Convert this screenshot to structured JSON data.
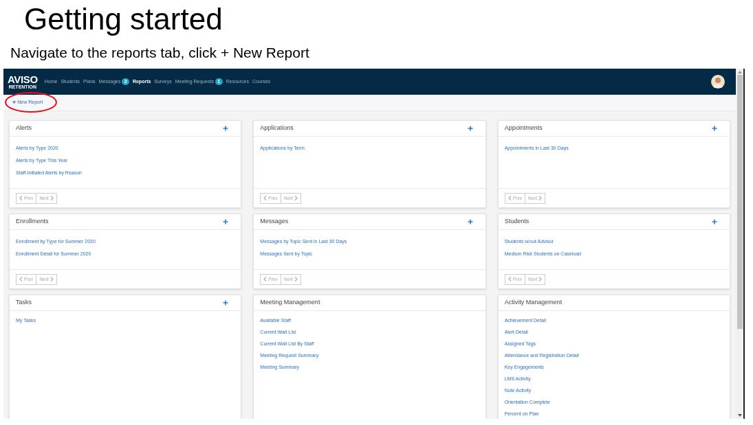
{
  "slide": {
    "title": "Getting started",
    "subtitle": "Navigate to the reports tab, click + New Report"
  },
  "app": {
    "logo": {
      "name": "AVISO",
      "tagline": "RETENTION"
    },
    "nav": [
      {
        "label": "Home",
        "selected": false
      },
      {
        "label": "Students",
        "selected": false
      },
      {
        "label": "Plans",
        "selected": false
      },
      {
        "label": "Messages",
        "badge": "2",
        "selected": false
      },
      {
        "label": "Reports",
        "selected": true
      },
      {
        "label": "Surveys",
        "selected": false
      },
      {
        "label": "Meeting Requests",
        "badge": "1",
        "selected": false
      },
      {
        "label": "Resources",
        "selected": false
      },
      {
        "label": "Courses",
        "selected": false
      }
    ],
    "toolbar": {
      "new_button": {
        "icon": "+",
        "label": "New Report",
        "highlighted": true
      }
    },
    "cards": [
      {
        "title": "Alerts",
        "addable": true,
        "links": [
          "Alerts by Type 2020",
          "Alerts by Type This Year",
          "Staff-Initiated Alerts by Reason"
        ],
        "pager": [
          {
            "label": "Prev",
            "kind": "prev",
            "disabled": true
          },
          {
            "label": "Next",
            "kind": "next",
            "disabled": true
          }
        ]
      },
      {
        "title": "Applications",
        "addable": true,
        "links": [
          "Applications by Term"
        ],
        "pager": [
          {
            "label": "Prev",
            "kind": "prev",
            "disabled": true
          },
          {
            "label": "Next",
            "kind": "next",
            "disabled": true
          }
        ]
      },
      {
        "title": "Appointments",
        "addable": true,
        "links": [
          "Appointments in Last 30 Days"
        ],
        "pager": [
          {
            "label": "Prev",
            "kind": "prev",
            "disabled": true
          },
          {
            "label": "Next",
            "kind": "next",
            "disabled": true
          }
        ]
      },
      {
        "title": "Enrollments",
        "addable": true,
        "links": [
          "Enrollment by Type for Summer 2020",
          "Enrollment Detail for Summer 2020"
        ],
        "pager": [
          {
            "label": "Prev",
            "kind": "prev",
            "disabled": true
          },
          {
            "label": "Next",
            "kind": "next",
            "disabled": true
          }
        ]
      },
      {
        "title": "Messages",
        "addable": true,
        "links": [
          "Messages by Topic Sent in Last 30 Days",
          "Messages Sent by Topic"
        ],
        "pager": [
          {
            "label": "Prev",
            "kind": "prev",
            "disabled": true
          },
          {
            "label": "Next",
            "kind": "next",
            "disabled": true
          }
        ]
      },
      {
        "title": "Students",
        "addable": true,
        "links": [
          "Students w/out Advisor",
          "Medium Risk Students on Caseload"
        ],
        "pager": [
          {
            "label": "Prev",
            "kind": "prev",
            "disabled": true
          },
          {
            "label": "Next",
            "kind": "next",
            "disabled": true
          }
        ]
      },
      {
        "title": "Tasks",
        "addable": true,
        "links": [
          "My Tasks"
        ]
      },
      {
        "title": "Meeting Management",
        "addable": false,
        "links": [
          "Available Staff",
          "Current Wait List",
          "Current Wait List By Staff",
          "Meeting Request Summary",
          "Meeting Summary"
        ]
      },
      {
        "title": "Activity Management",
        "addable": false,
        "links": [
          "Achievement Detail",
          "Alert Detail",
          "Assigned Tags",
          "Attendance and Registration Detail",
          "Key Engagements",
          "LMS Activity",
          "Note Activity",
          "Orientation Complete",
          "Percent on Plan"
        ]
      }
    ]
  }
}
